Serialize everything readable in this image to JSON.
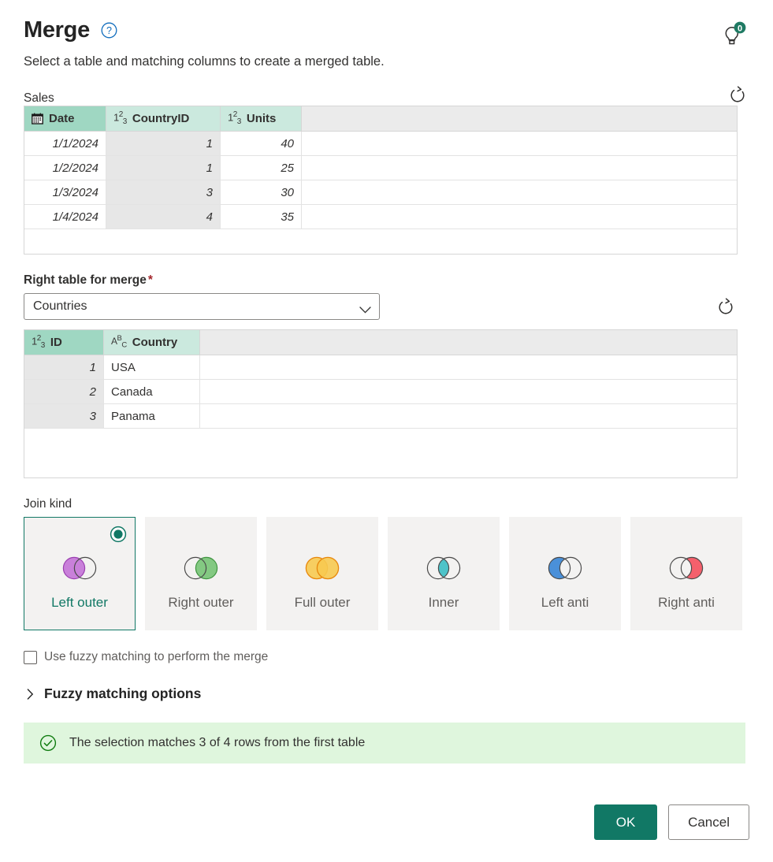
{
  "dialog": {
    "title": "Merge",
    "subtitle": "Select a table and matching columns to create a merged table.",
    "help_icon": "question-circle-icon",
    "tips_icon": "lightbulb-icon",
    "tips_count": "0",
    "accent_color": "#117865"
  },
  "left_table": {
    "name": "Sales",
    "refresh_icon": "refresh-icon",
    "columns": [
      {
        "name": "Date",
        "type_icon": "calendar-icon",
        "selected": true,
        "align": "num"
      },
      {
        "name": "CountryID",
        "type_icon": "number-123-icon",
        "selected": true,
        "align": "num"
      },
      {
        "name": "Units",
        "type_icon": "number-123-icon",
        "selected": false,
        "align": "num"
      }
    ],
    "rows": [
      [
        "1/1/2024",
        "1",
        "40"
      ],
      [
        "1/2/2024",
        "1",
        "25"
      ],
      [
        "1/3/2024",
        "3",
        "30"
      ],
      [
        "1/4/2024",
        "4",
        "35"
      ]
    ]
  },
  "right_table_picker": {
    "label": "Right table for merge",
    "required_marker": "*",
    "selected_value": "Countries",
    "options": [
      "Countries"
    ],
    "chevron_icon": "chevron-down-icon",
    "refresh_icon": "refresh-icon"
  },
  "right_table": {
    "columns": [
      {
        "name": "ID",
        "type_icon": "number-123-icon",
        "selected": true,
        "align": "num"
      },
      {
        "name": "Country",
        "type_icon": "text-abc-icon",
        "selected": false,
        "align": "txt"
      }
    ],
    "rows": [
      [
        "1",
        "USA"
      ],
      [
        "2",
        "Canada"
      ],
      [
        "3",
        "Panama"
      ]
    ]
  },
  "join_kind": {
    "label": "Join kind",
    "selected": "Left outer",
    "options": [
      {
        "label": "Left outer",
        "venn": "left-outer-venn-icon",
        "fill": "#b760c8",
        "side": "left",
        "selected": true
      },
      {
        "label": "Right outer",
        "venn": "right-outer-venn-icon",
        "fill": "#6abf69",
        "side": "right",
        "selected": false
      },
      {
        "label": "Full outer",
        "venn": "full-outer-venn-icon",
        "fill": "#f5c342",
        "side": "both",
        "selected": false
      },
      {
        "label": "Inner",
        "venn": "inner-venn-icon",
        "fill": "#4ec3c9",
        "side": "inner",
        "selected": false
      },
      {
        "label": "Left anti",
        "venn": "left-anti-venn-icon",
        "fill": "#4a90d9",
        "side": "leftonly",
        "selected": false
      },
      {
        "label": "Right anti",
        "venn": "right-anti-venn-icon",
        "fill": "#f4606c",
        "side": "rightonly",
        "selected": false
      }
    ]
  },
  "fuzzy": {
    "checkbox_label": "Use fuzzy matching to perform the merge",
    "checked": false,
    "expander_label": "Fuzzy matching options",
    "expander_icon": "chevron-right-icon",
    "expanded": false
  },
  "status": {
    "icon": "check-circle-icon",
    "message": "The selection matches 3 of 4 rows from the first table",
    "background": "#dff6dd",
    "icon_color": "#107c10"
  },
  "footer": {
    "ok_label": "OK",
    "cancel_label": "Cancel"
  }
}
